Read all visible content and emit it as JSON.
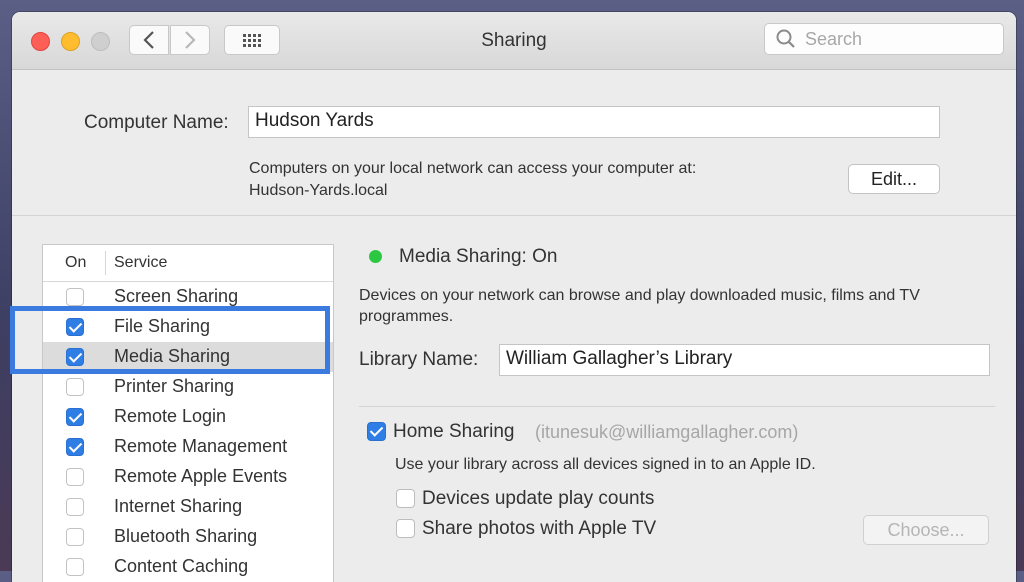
{
  "window": {
    "title": "Sharing",
    "search_placeholder": "Search"
  },
  "computer_name": {
    "label": "Computer Name:",
    "value": "Hudson Yards",
    "description_line1": "Computers on your local network can access your computer at:",
    "description_line2": "Hudson-Yards.local",
    "edit_label": "Edit..."
  },
  "services": {
    "header_on": "On",
    "header_service": "Service",
    "items": [
      {
        "label": "Screen Sharing",
        "checked": false
      },
      {
        "label": "File Sharing",
        "checked": true
      },
      {
        "label": "Media Sharing",
        "checked": true,
        "selected": true
      },
      {
        "label": "Printer Sharing",
        "checked": false
      },
      {
        "label": "Remote Login",
        "checked": true
      },
      {
        "label": "Remote Management",
        "checked": true
      },
      {
        "label": "Remote Apple Events",
        "checked": false
      },
      {
        "label": "Internet Sharing",
        "checked": false
      },
      {
        "label": "Bluetooth Sharing",
        "checked": false
      },
      {
        "label": "Content Caching",
        "checked": false
      }
    ]
  },
  "detail": {
    "status_title": "Media Sharing: On",
    "status_color": "#2dc842",
    "description": "Devices on your network can browse and play downloaded music, films and TV programmes.",
    "library_label": "Library Name:",
    "library_value": "William Gallagher’s Library",
    "home_sharing_label": "Home Sharing",
    "home_sharing_checked": true,
    "home_sharing_account": "(itunesuk@williamgallagher.com)",
    "home_sharing_desc": "Use your library across all devices signed in to an Apple ID.",
    "option_play_counts": "Devices update play counts",
    "option_play_counts_checked": false,
    "option_photos": "Share photos with Apple TV",
    "option_photos_checked": false,
    "choose_label": "Choose..."
  },
  "colors": {
    "accent": "#2f7ee6",
    "highlight_box": "#3b7be0"
  }
}
